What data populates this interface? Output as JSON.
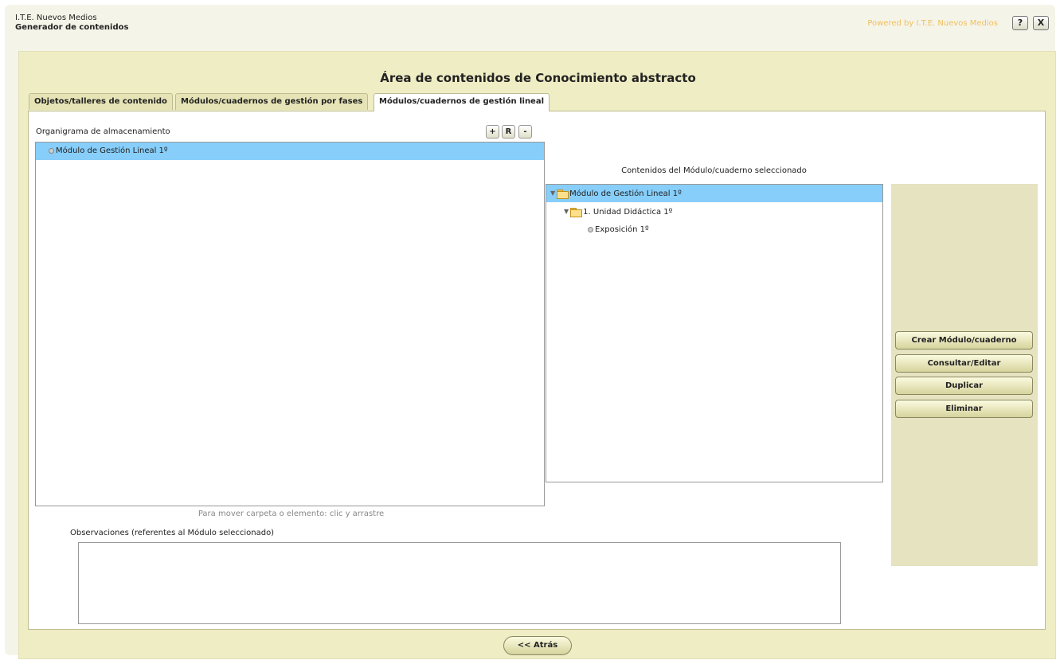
{
  "header": {
    "org_name": "I.T.E. Nuevos Medios",
    "app_name": "Generador de contenidos",
    "powered_by": "Powered by I.T.E. Nuevos Medios",
    "help_label": "?",
    "close_label": "X"
  },
  "area": {
    "title": "Área de contenidos de Conocimiento abstracto"
  },
  "tabs": [
    {
      "label": "Objetos/talleres de contenido"
    },
    {
      "label": "Módulos/cuadernos de gestión por fases"
    },
    {
      "label": "Módulos/cuadernos de gestión lineal",
      "active": true
    }
  ],
  "left_panel": {
    "title": "Organigrama de almacenamiento",
    "add_label": "+",
    "rename_label": "R",
    "remove_label": "-",
    "items": [
      {
        "label": "Módulo de Gestión Lineal 1º",
        "selected": true
      }
    ],
    "move_hint": "Para mover carpeta o elemento: clic y arrastre"
  },
  "observations": {
    "label": "Observaciones (referentes al Módulo seleccionado)",
    "value": ""
  },
  "right_panel": {
    "title": "Contenidos del Módulo/cuaderno seleccionado",
    "items": [
      {
        "label": "Módulo de Gestión Lineal 1º",
        "type": "folder",
        "level": 0,
        "expanded": true,
        "selected": true
      },
      {
        "label": "1. Unidad Didáctica 1º",
        "type": "folder",
        "level": 1,
        "expanded": true
      },
      {
        "label": "Exposición 1º",
        "type": "item",
        "level": 2
      }
    ]
  },
  "actions": {
    "create": "Crear Módulo/cuaderno",
    "edit": "Consultar/Editar",
    "duplicate": "Duplicar",
    "delete": "Eliminar"
  },
  "footer": {
    "back_label": "<< Atrás"
  },
  "colors": {
    "panel_bg": "#efedc4",
    "selection": "#87cefa",
    "powered_text": "#f0c060"
  }
}
